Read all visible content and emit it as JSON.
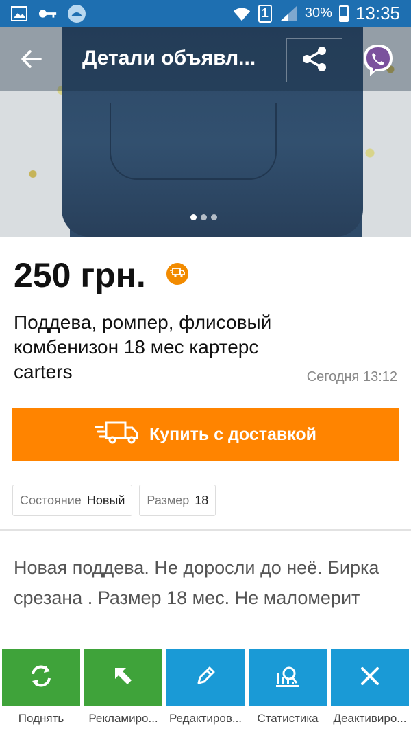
{
  "status_bar": {
    "battery_percent": "30%",
    "time": "13:35",
    "sim_slot": "1",
    "battery_level": 0.3,
    "icons": [
      "gallery-icon",
      "key-icon",
      "app-icon",
      "wifi-icon",
      "signal-icon"
    ]
  },
  "toolbar": {
    "title": "Детали объявл...",
    "icons": [
      "back-arrow-icon",
      "share-icon",
      "viber-icon"
    ]
  },
  "gallery": {
    "page_count": 3,
    "active_index": 0
  },
  "listing": {
    "price": "250 грн.",
    "title": "Поддева, ромпер, флисовый комбенизон 18 мес картерс carters",
    "posted": "Сегодня 13:12",
    "buy_label": "Купить с доставкой",
    "params": [
      {
        "key": "Состояние",
        "value": "Новый"
      },
      {
        "key": "Размер",
        "value": "18"
      }
    ],
    "description": "Новая поддева. Не доросли до неё. Бирка срезана . Размер 18 мес. Не маломерит"
  },
  "actions": [
    {
      "label": "Поднять",
      "icon": "refresh-icon",
      "color": "#3fa33a"
    },
    {
      "label": "Рекламиро...",
      "icon": "cursor-arrow-icon",
      "color": "#3fa33a"
    },
    {
      "label": "Редактиров...",
      "icon": "pencil-icon",
      "color": "#1a9ad6"
    },
    {
      "label": "Статистика",
      "icon": "stats-icon",
      "color": "#1a9ad6"
    },
    {
      "label": "Деактивиро...",
      "icon": "close-icon",
      "color": "#1a9ad6"
    }
  ],
  "colors": {
    "status_bar": "#1e6fb1",
    "accent_orange": "#ff8400",
    "action_green": "#3fa33a",
    "action_blue": "#1a9ad6"
  }
}
